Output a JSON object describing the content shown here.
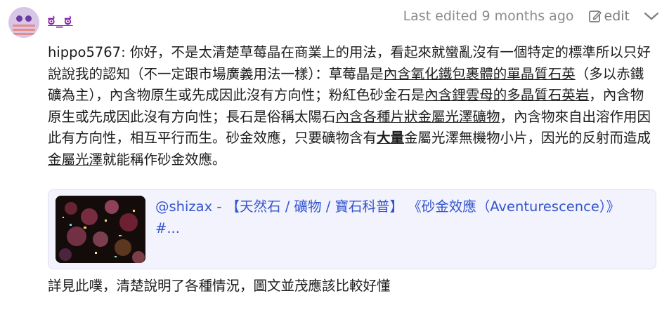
{
  "post": {
    "username": "ಠ_ಠ",
    "last_edited": "Last edited 9 months ago",
    "edit_label": "edit",
    "body": {
      "p1": "hippo5767: 你好，不是太清楚草莓晶在商業上的用法，看起來就蠻亂沒有一個特定的標準所以只好說說我的認知（不一定跟市場廣義用法一樣）：草莓晶是",
      "u1": "內含氧化鐵包裹體的單晶質石英",
      "p2": "（多以赤鐵礦為主），內含物原生或先成因此沒有方向性；粉紅色砂金石是",
      "u2": "內含鋰雲母的多晶質石英岩",
      "p3": "，內含物原生或先成因此沒有方向性；長石是俗稱太陽石",
      "u3": "內含各種片狀金屬光澤礦物",
      "p4": "，內含物來自出溶作用因此有方向性，相互平行而生。砂金效應，只要礦物含有",
      "b1": "大量",
      "p5": "金屬光澤無機物小片，因光的反射而造成",
      "u4": "金屬光澤",
      "p6": "就能稱作砂金效應。"
    },
    "card": {
      "title": "@shizax - 【天然石 / 礦物 / 寶石科普】 《砂金效應（Aventurescence）》 #..."
    },
    "footer": "詳見此噗，清楚說明了各種情況，圖文並茂應該比較好懂"
  },
  "colors": {
    "username": "#8a1fb0",
    "link": "#3355cc",
    "card_bg": "#f3f3fe",
    "meta": "#8c8c8c"
  },
  "icons": {
    "edit": "edit-square-pen-icon",
    "chevron": "chevron-down-icon"
  }
}
